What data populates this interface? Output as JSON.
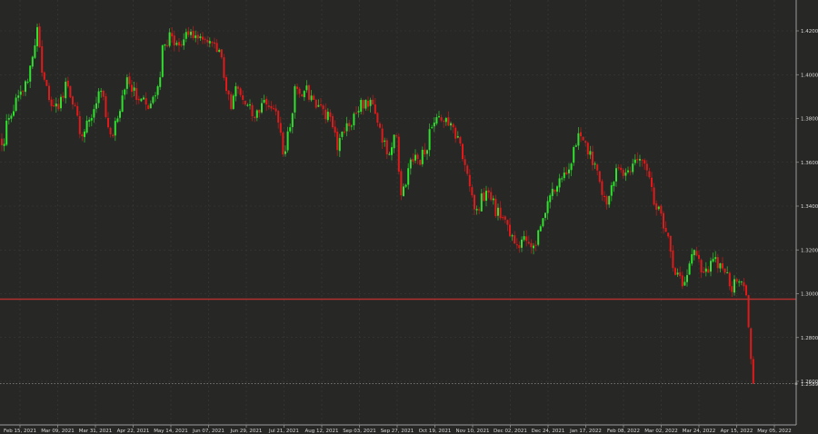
{
  "chart_data": {
    "type": "candlestick",
    "title": "",
    "xlabel": "",
    "ylabel": "",
    "ylim": [
      1.2345,
      1.4335
    ],
    "grid": true,
    "y_ticks": [
      "1.4200",
      "1.4000",
      "1.3800",
      "1.3600",
      "1.3400",
      "1.3200",
      "1.3000",
      "1.2800",
      "1.2600"
    ],
    "y_tick_values": [
      1.42,
      1.4,
      1.38,
      1.36,
      1.34,
      1.32,
      1.3,
      1.28,
      1.26
    ],
    "x_ticks": [
      "Feb 15, 2021",
      "Mar 09, 2021",
      "Mar 31, 2021",
      "Apr 22, 2021",
      "May 14, 2021",
      "Jun 07, 2021",
      "Jun 29, 2021",
      "Jul 21, 2021",
      "Aug 12, 2021",
      "Sep 03, 2021",
      "Sep 27, 2021",
      "Oct 19, 2021",
      "Nov 10, 2021",
      "Dec 02, 2021",
      "Dec 24, 2021",
      "Jan 17, 2022",
      "Feb 08, 2022",
      "Mar 02, 2022",
      "Mar 24, 2022",
      "Apr 15, 2022",
      "May 05, 2022"
    ],
    "support_line": 1.2975,
    "last_price": 1.2589,
    "last_price_label": "1.2589",
    "colors": {
      "up": "#2fe02f",
      "down": "#e01a1a",
      "support": "#b3302c",
      "background": "#272826",
      "grid": "#3c3d3b"
    },
    "close_anchors": [
      [
        0,
        1.3678
      ],
      [
        3,
        1.3802
      ],
      [
        7,
        1.3905
      ],
      [
        11,
        1.3968
      ],
      [
        14,
        1.4134
      ],
      [
        15,
        1.4217
      ],
      [
        17,
        1.4009
      ],
      [
        20,
        1.3885
      ],
      [
        24,
        1.3843
      ],
      [
        27,
        1.3968
      ],
      [
        30,
        1.3864
      ],
      [
        34,
        1.3719
      ],
      [
        38,
        1.3802
      ],
      [
        42,
        1.3926
      ],
      [
        45,
        1.376
      ],
      [
        47,
        1.3719
      ],
      [
        51,
        1.3905
      ],
      [
        53,
        1.3988
      ],
      [
        57,
        1.3885
      ],
      [
        61,
        1.3864
      ],
      [
        65,
        1.3905
      ],
      [
        67,
        1.3988
      ],
      [
        68,
        1.4134
      ],
      [
        72,
        1.4175
      ],
      [
        76,
        1.4134
      ],
      [
        80,
        1.4196
      ],
      [
        84,
        1.4175
      ],
      [
        88,
        1.4154
      ],
      [
        92,
        1.4113
      ],
      [
        95,
        1.3926
      ],
      [
        97,
        1.3843
      ],
      [
        99,
        1.3947
      ],
      [
        103,
        1.3864
      ],
      [
        107,
        1.3802
      ],
      [
        111,
        1.3885
      ],
      [
        115,
        1.3843
      ],
      [
        117,
        1.3781
      ],
      [
        119,
        1.3636
      ],
      [
        122,
        1.376
      ],
      [
        124,
        1.3947
      ],
      [
        128,
        1.3926
      ],
      [
        132,
        1.3885
      ],
      [
        136,
        1.3843
      ],
      [
        140,
        1.376
      ],
      [
        142,
        1.3656
      ],
      [
        145,
        1.3739
      ],
      [
        149,
        1.3822
      ],
      [
        152,
        1.3885
      ],
      [
        157,
        1.3864
      ],
      [
        159,
        1.3781
      ],
      [
        163,
        1.3636
      ],
      [
        167,
        1.3719
      ],
      [
        169,
        1.3449
      ],
      [
        172,
        1.3573
      ],
      [
        176,
        1.3615
      ],
      [
        179,
        1.3636
      ],
      [
        182,
        1.376
      ],
      [
        185,
        1.381
      ],
      [
        188,
        1.3802
      ],
      [
        191,
        1.376
      ],
      [
        193,
        1.3719
      ],
      [
        195,
        1.3615
      ],
      [
        199,
        1.3449
      ],
      [
        201,
        1.3387
      ],
      [
        205,
        1.347
      ],
      [
        207,
        1.3428
      ],
      [
        211,
        1.3345
      ],
      [
        215,
        1.3262
      ],
      [
        218,
        1.3221
      ],
      [
        222,
        1.3241
      ],
      [
        226,
        1.3221
      ],
      [
        229,
        1.3345
      ],
      [
        232,
        1.3449
      ],
      [
        235,
        1.349
      ],
      [
        238,
        1.3553
      ],
      [
        241,
        1.3594
      ],
      [
        243,
        1.3677
      ],
      [
        245,
        1.3719
      ],
      [
        248,
        1.3636
      ],
      [
        251,
        1.3594
      ],
      [
        253,
        1.3511
      ],
      [
        256,
        1.3407
      ],
      [
        259,
        1.3511
      ],
      [
        261,
        1.3573
      ],
      [
        264,
        1.3553
      ],
      [
        267,
        1.3594
      ],
      [
        270,
        1.3615
      ],
      [
        272,
        1.3594
      ],
      [
        274,
        1.3532
      ],
      [
        276,
        1.3407
      ],
      [
        279,
        1.3366
      ],
      [
        282,
        1.3262
      ],
      [
        284,
        1.3117
      ],
      [
        286,
        1.3096
      ],
      [
        288,
        1.3034
      ],
      [
        291,
        1.3138
      ],
      [
        293,
        1.32
      ],
      [
        295,
        1.3159
      ],
      [
        297,
        1.3096
      ],
      [
        299,
        1.3096
      ],
      [
        301,
        1.3159
      ],
      [
        303,
        1.3117
      ],
      [
        306,
        1.3096
      ],
      [
        308,
        1.3034
      ],
      [
        311,
        1.3055
      ],
      [
        314,
        1.3034
      ],
      [
        315,
        1.2993
      ],
      [
        316,
        1.2847
      ],
      [
        317,
        1.2702
      ],
      [
        318,
        1.2589
      ]
    ]
  }
}
